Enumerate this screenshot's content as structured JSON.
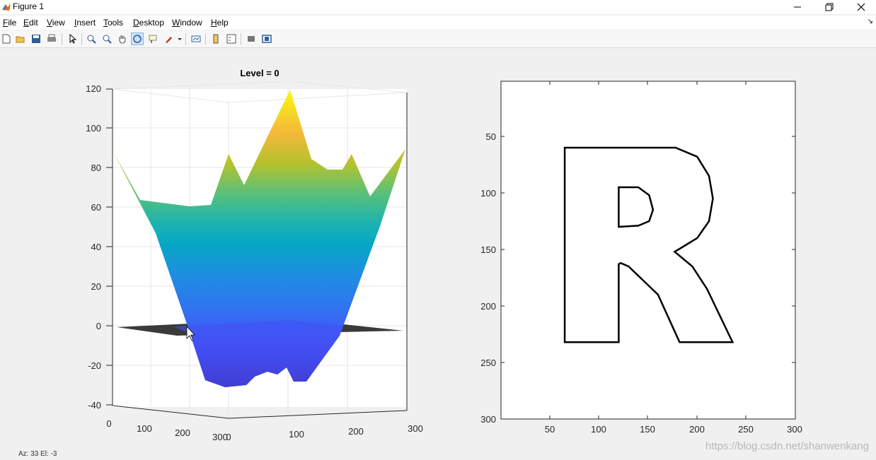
{
  "window": {
    "title": "Figure 1"
  },
  "menu": [
    {
      "mn": "F",
      "rest": "ile"
    },
    {
      "mn": "E",
      "rest": "dit"
    },
    {
      "mn": "V",
      "rest": "iew"
    },
    {
      "mn": "I",
      "rest": "nsert"
    },
    {
      "mn": "T",
      "rest": "ools"
    },
    {
      "mn": "D",
      "rest": "esktop"
    },
    {
      "mn": "W",
      "rest": "indow"
    },
    {
      "mn": "H",
      "rest": "elp"
    }
  ],
  "toolbar": {
    "icons": [
      "new-figure-icon",
      "open-file-icon",
      "save-icon",
      "print-icon",
      "select-arrow-icon",
      "zoom-in-icon",
      "zoom-out-icon",
      "pan-hand-icon",
      "rotate-3d-icon",
      "data-cursor-icon",
      "brush-icon",
      "link-plot-icon",
      "colorbar-icon",
      "legend-icon",
      "hide-plot-tools-icon",
      "show-plot-tools-icon"
    ]
  },
  "plot3d": {
    "title": "Level = 0",
    "z_ticks": [
      "120",
      "100",
      "80",
      "60",
      "40",
      "20",
      "0",
      "-20",
      "-40"
    ],
    "x_ticks": [
      "0",
      "100",
      "200",
      "300"
    ],
    "y_ticks": [
      "0",
      "100",
      "200",
      "300"
    ]
  },
  "plot2d": {
    "y_ticks": [
      "50",
      "100",
      "150",
      "200",
      "250",
      "300"
    ],
    "x_ticks": [
      "50",
      "100",
      "150",
      "200",
      "250",
      "300"
    ]
  },
  "chart_data": {
    "type": "surface-and-contour",
    "surface": {
      "title": "Level = 0",
      "zlim": [
        -40,
        120
      ],
      "xlim": [
        0,
        300
      ],
      "ylim": [
        0,
        300
      ],
      "zero_plane_level": 0,
      "colormap": "parula",
      "z_peak": 118,
      "z_min": -30
    },
    "contour": {
      "xlim": [
        0,
        300
      ],
      "ylim": [
        0,
        300
      ],
      "y_reversed": true,
      "shape": "R",
      "outer_path": [
        [
          65,
          60
        ],
        [
          178,
          60
        ],
        [
          200,
          68
        ],
        [
          212,
          85
        ],
        [
          216,
          105
        ],
        [
          212,
          125
        ],
        [
          200,
          140
        ],
        [
          181,
          150
        ],
        [
          177,
          152
        ],
        [
          195,
          165
        ],
        [
          210,
          185
        ],
        [
          236,
          232
        ],
        [
          182,
          232
        ],
        [
          160,
          190
        ],
        [
          130,
          165
        ],
        [
          122,
          162
        ],
        [
          120,
          163
        ],
        [
          120,
          232
        ],
        [
          65,
          232
        ],
        [
          65,
          60
        ]
      ],
      "inner_path": [
        [
          120,
          95
        ],
        [
          140,
          95
        ],
        [
          151,
          102
        ],
        [
          155,
          115
        ],
        [
          151,
          125
        ],
        [
          140,
          129
        ],
        [
          120,
          130
        ],
        [
          120,
          95
        ]
      ]
    }
  },
  "status": {
    "text": "Az:  33 El:  -3"
  },
  "watermark": "https://blog.csdn.net/shanwenkang"
}
